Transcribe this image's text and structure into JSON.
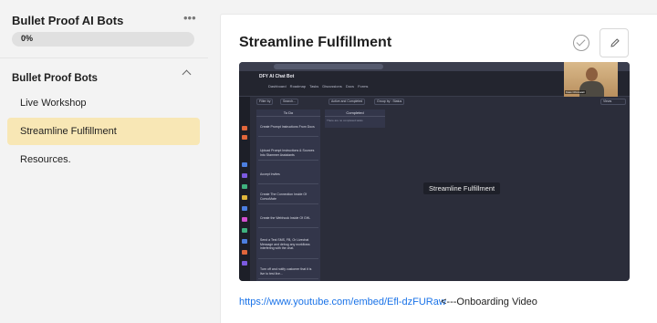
{
  "sidebar": {
    "course_title": "Bullet Proof AI Bots",
    "more_icon": "ellipsis-icon",
    "progress_label": "0%",
    "progress_value": 0,
    "section_title": "Bullet Proof Bots",
    "section_icon": "chevron-up-icon",
    "items": [
      {
        "label": "Live Workshop",
        "active": false
      },
      {
        "label": "Streamline Fulfillment",
        "active": true
      },
      {
        "label": "Resources.",
        "active": false
      }
    ],
    "active_color": "#f8e7b5"
  },
  "lesson": {
    "title": "Streamline Fulfillment",
    "complete_icon": "check-circle-icon",
    "edit_icon": "pencil-icon",
    "link_text": "https://www.youtube.com/embed/Efl-dzFURaw",
    "link_suffix": " <---Onboarding Video",
    "link_color": "#1a73e8"
  },
  "video": {
    "app_title": "DFY AI Chat Bot",
    "tabs": "Dashboard Roadmap Tasks Discussions Docs Forms",
    "filter_label": "Filter by",
    "search_label": "Search...",
    "status_filter": "Active and Completed",
    "group_label": "Group by : Status",
    "views_label": "Views",
    "todo_column": "To Do",
    "completed_column": "Completed",
    "completed_empty": "There are no completed tasks",
    "cards": [
      "Create Prompt Instructions From Docs",
      "Upload Prompt Instructions & Sources Into Stammer Assistants",
      "Accept Invites",
      "Create The Connection Inside Of ConvoMate",
      "Create the Webhook Inside Of GHL",
      "Send a Test SMS, FB, Or Livechat Message and debug any workflows interfering with the chat.",
      "Turn off and notify customer that it is live to test live..."
    ],
    "caption": "Streamline Fulfillment",
    "presenter_name": "Kass Chinnaiah"
  }
}
